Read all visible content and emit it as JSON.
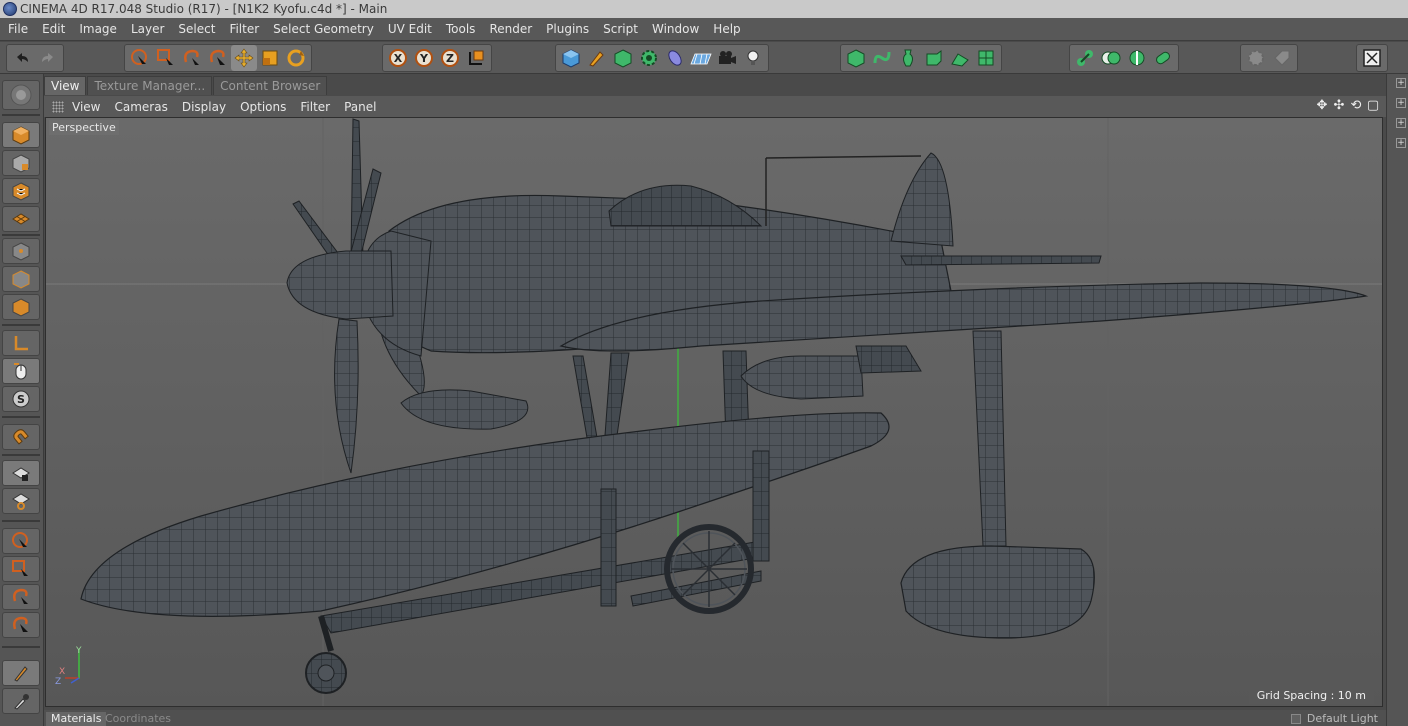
{
  "window": {
    "title": "CINEMA 4D R17.048 Studio (R17) - [N1K2 Kyofu.c4d *] - Main"
  },
  "menu": [
    "File",
    "Edit",
    "Image",
    "Layer",
    "Select",
    "Filter",
    "Select Geometry",
    "UV Edit",
    "Tools",
    "Render",
    "Plugins",
    "Script",
    "Window",
    "Help"
  ],
  "view_tabs": [
    "View",
    "Texture Manager...",
    "Content Browser"
  ],
  "viewport_menu": [
    "View",
    "Cameras",
    "Display",
    "Options",
    "Filter",
    "Panel"
  ],
  "viewport": {
    "label": "Perspective",
    "grid_spacing": "Grid Spacing : 10 m"
  },
  "axes": {
    "x": "X",
    "y": "Y",
    "z": "Z"
  },
  "coord_buttons": [
    "X",
    "Y",
    "Z"
  ],
  "bottom_tabs": [
    "Materials",
    "Coordinates"
  ],
  "default_light": "Default Light",
  "colors": {
    "accent": "#d28a2a",
    "blue": "#3f8fd6",
    "green": "#3fbf6f"
  }
}
